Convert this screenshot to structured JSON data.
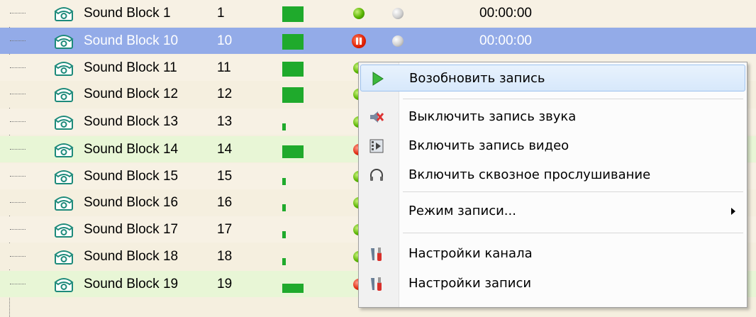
{
  "rows": [
    {
      "name": "Sound Block 1",
      "num": "1",
      "level": 1.0,
      "status": "green",
      "time": "00:00:00"
    },
    {
      "name": "Sound Block 10",
      "num": "10",
      "level": 1.0,
      "status": "paused",
      "time": "00:00:00",
      "selected": true
    },
    {
      "name": "Sound Block 11",
      "num": "11",
      "level": 0.95,
      "status": "green",
      "time": ""
    },
    {
      "name": "Sound Block 12",
      "num": "12",
      "level": 1.0,
      "status": "green",
      "time": ""
    },
    {
      "name": "Sound Block 13",
      "num": "13",
      "level": 0.45,
      "status": "green",
      "time": ""
    },
    {
      "name": "Sound Block 14",
      "num": "14",
      "level": 0.8,
      "status": "red",
      "time": ""
    },
    {
      "name": "Sound Block 15",
      "num": "15",
      "level": 0.45,
      "status": "green",
      "time": ""
    },
    {
      "name": "Sound Block 16",
      "num": "16",
      "level": 0.45,
      "status": "green",
      "time": ""
    },
    {
      "name": "Sound Block 17",
      "num": "17",
      "level": 0.45,
      "status": "green",
      "time": ""
    },
    {
      "name": "Sound Block 18",
      "num": "18",
      "level": 0.45,
      "status": "green",
      "time": ""
    },
    {
      "name": "Sound Block 19",
      "num": "19",
      "level": 0.6,
      "status": "red",
      "time": ""
    }
  ],
  "context_menu": {
    "items": [
      {
        "label": "Возобновить запись",
        "icon": "play-icon",
        "hover": true
      },
      {
        "label": "Выключить запись звука",
        "icon": "speaker-mute-icon"
      },
      {
        "label": "Включить запись видео",
        "icon": "film-icon"
      },
      {
        "label": "Включить сквозное прослушивание",
        "icon": "headphones-icon"
      },
      {
        "label": "Режим записи...",
        "icon": "",
        "submenu": true
      },
      {
        "label": "Настройки канала",
        "icon": "tools-icon"
      },
      {
        "label": "Настройки записи",
        "icon": "tools-icon"
      }
    ]
  },
  "colors": {
    "selection": "#93abe8",
    "level_green": "#1faa2c",
    "menu_hover": "#d7e8fb"
  }
}
